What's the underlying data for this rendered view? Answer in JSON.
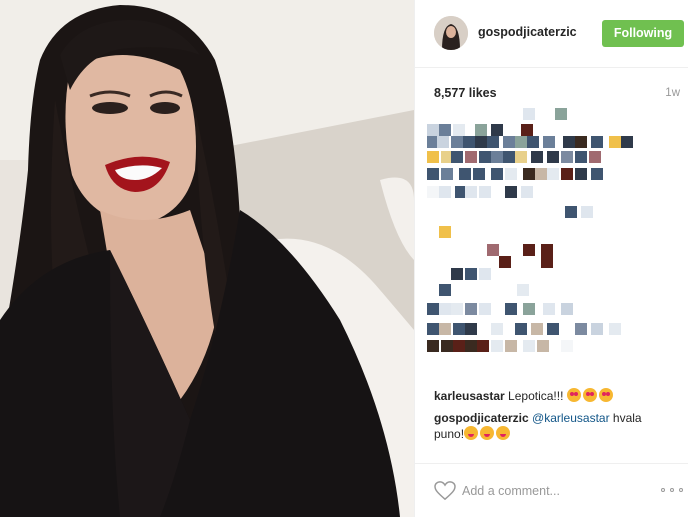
{
  "post": {
    "username": "gospodjicaterzic",
    "follow_label": "Following",
    "likes": "8,577 likes",
    "age": "1w",
    "photo_alt": "selfie photo"
  },
  "comments": [
    {
      "user": "karleusastar",
      "text": " Lepotica!!!",
      "emoji": "heart-eyes-emoji"
    },
    {
      "user": "gospodjicaterzic",
      "mention": "@karleusastar",
      "text": " hvala puno!",
      "emoji": "yum-emoji"
    }
  ],
  "footer": {
    "comment_placeholder": "Add a comment..."
  },
  "colors": {
    "follow_button": "#70c050",
    "mention": "#125688",
    "divider": "#efefef"
  }
}
